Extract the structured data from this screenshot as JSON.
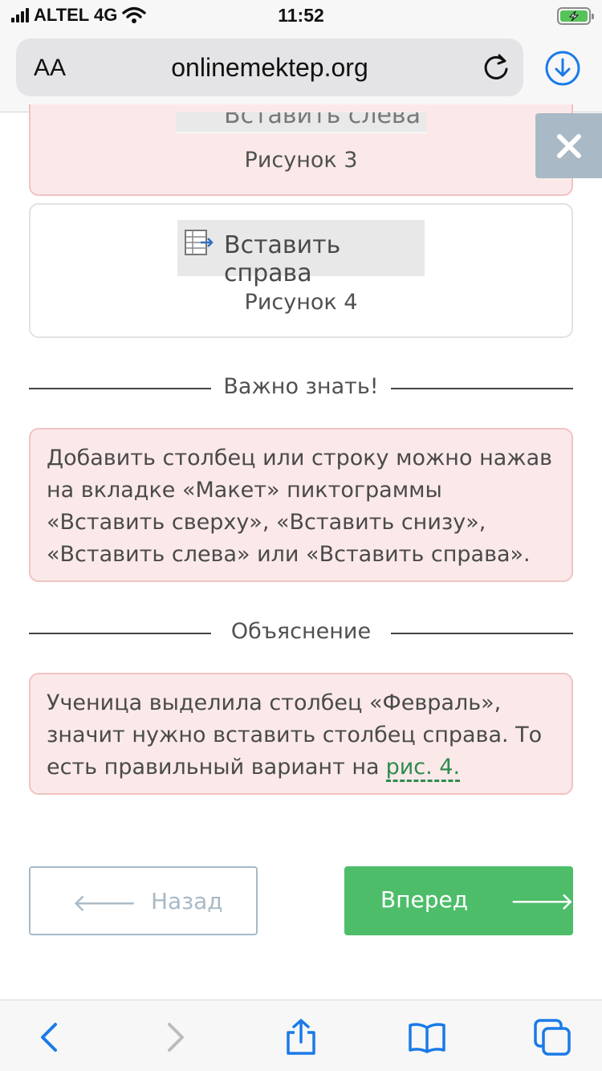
{
  "status_bar": {
    "carrier": "ALTEL 4G",
    "time": "11:52"
  },
  "browser": {
    "text_size_label": "AA",
    "url": "onlinemektep.org"
  },
  "figures": {
    "fig3_label": "Рисунок 3",
    "fig4_label": "Рисунок 4",
    "fig3_image_text": "Вставить слева",
    "fig4_image_text": "Вставить справа"
  },
  "sections": {
    "important_heading": "Важно знать!",
    "important_text": "Добавить столбец или строку можно нажав на вкладке «Макет» пиктограммы «Вставить сверху», «Вставить снизу», «Вставить слева» или «Вставить справа».",
    "explanation_heading": "Объяснение",
    "explanation_text": "Ученица выделила столбец «Февраль», значит нужно вставить столбец справа. То есть правильный вариант на",
    "explanation_link": "рис. 4."
  },
  "navigation": {
    "back_label": "Назад",
    "next_label": "Вперед"
  },
  "colors": {
    "accent_green": "#4dbd6a",
    "note_bg": "#fbe9e9",
    "muted_blue": "#a9b9c5"
  }
}
